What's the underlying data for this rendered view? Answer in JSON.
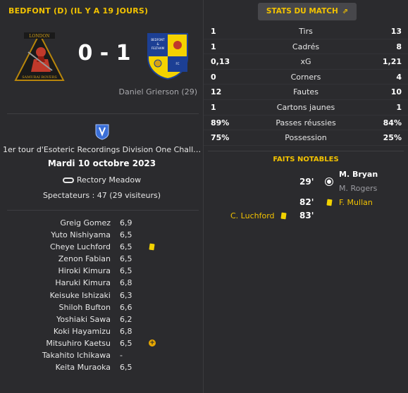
{
  "header": {
    "title": "BEDFONT (D) (IL Y A 19 JOURS)"
  },
  "match": {
    "home_crest_icon": "samurai-rovers-crest-icon",
    "home_crest_text": "LONDON SAMURAI ROVERS",
    "away_crest_icon": "bedfont-feltham-crest-icon",
    "away_crest_text": "BEDFONT & FELTHAM FOOTBALL CLUB",
    "score": "0 - 1",
    "scorer": "Daniel Grierson (29)",
    "competition": "1er tour d'Esoteric Recordings Division One Challe…",
    "date": "Mardi 10 octobre 2023",
    "venue": "Rectory Meadow",
    "spectators": "Spectateurs : 47 (29 visiteurs)"
  },
  "players": [
    {
      "name": "Greig Gomez",
      "rating": "6,9",
      "event": ""
    },
    {
      "name": "Yuto Nishiyama",
      "rating": "6,5",
      "event": ""
    },
    {
      "name": "Cheye Luchford",
      "rating": "6,5",
      "event": "yellow-card"
    },
    {
      "name": "Zenon Fabian",
      "rating": "6,5",
      "event": ""
    },
    {
      "name": "Hiroki Kimura",
      "rating": "6,5",
      "event": ""
    },
    {
      "name": "Haruki Kimura",
      "rating": "6,8",
      "event": ""
    },
    {
      "name": "Keisuke Ishizaki",
      "rating": "6,3",
      "event": ""
    },
    {
      "name": "Shiloh Bufton",
      "rating": "6,6",
      "event": ""
    },
    {
      "name": "Yoshiaki Sawa",
      "rating": "6,2",
      "event": ""
    },
    {
      "name": "Koki Hayamizu",
      "rating": "6,8",
      "event": ""
    },
    {
      "name": "Mitsuhiro Kaetsu",
      "rating": "6,5",
      "event": "substitution"
    },
    {
      "name": "Takahito Ichikawa",
      "rating": "-",
      "event": ""
    },
    {
      "name": "Keita Muraoka",
      "rating": "6,5",
      "event": ""
    }
  ],
  "stats_button": {
    "label": "STATS DU MATCH"
  },
  "stats": [
    {
      "home": "1",
      "label": "Tirs",
      "away": "13"
    },
    {
      "home": "1",
      "label": "Cadrés",
      "away": "8"
    },
    {
      "home": "0,13",
      "label": "xG",
      "away": "1,21"
    },
    {
      "home": "0",
      "label": "Corners",
      "away": "4"
    },
    {
      "home": "12",
      "label": "Fautes",
      "away": "10"
    },
    {
      "home": "1",
      "label": "Cartons jaunes",
      "away": "1"
    },
    {
      "home": "89%",
      "label": "Passes réussies",
      "away": "84%"
    },
    {
      "home": "75%",
      "label": "Possession",
      "away": "25%"
    }
  ],
  "events": {
    "title": "FAITS NOTABLES",
    "goal": {
      "minute": "29'",
      "scorer": "M. Bryan",
      "assist": "M. Rogers"
    },
    "away_card": {
      "minute": "82'",
      "player": "F. Mullan"
    },
    "home_card": {
      "minute": "83'",
      "player": "C. Luchford"
    }
  },
  "colors": {
    "accent": "#f2c200",
    "background": "#2b2b2e",
    "yellow_card": "#f2d200"
  }
}
